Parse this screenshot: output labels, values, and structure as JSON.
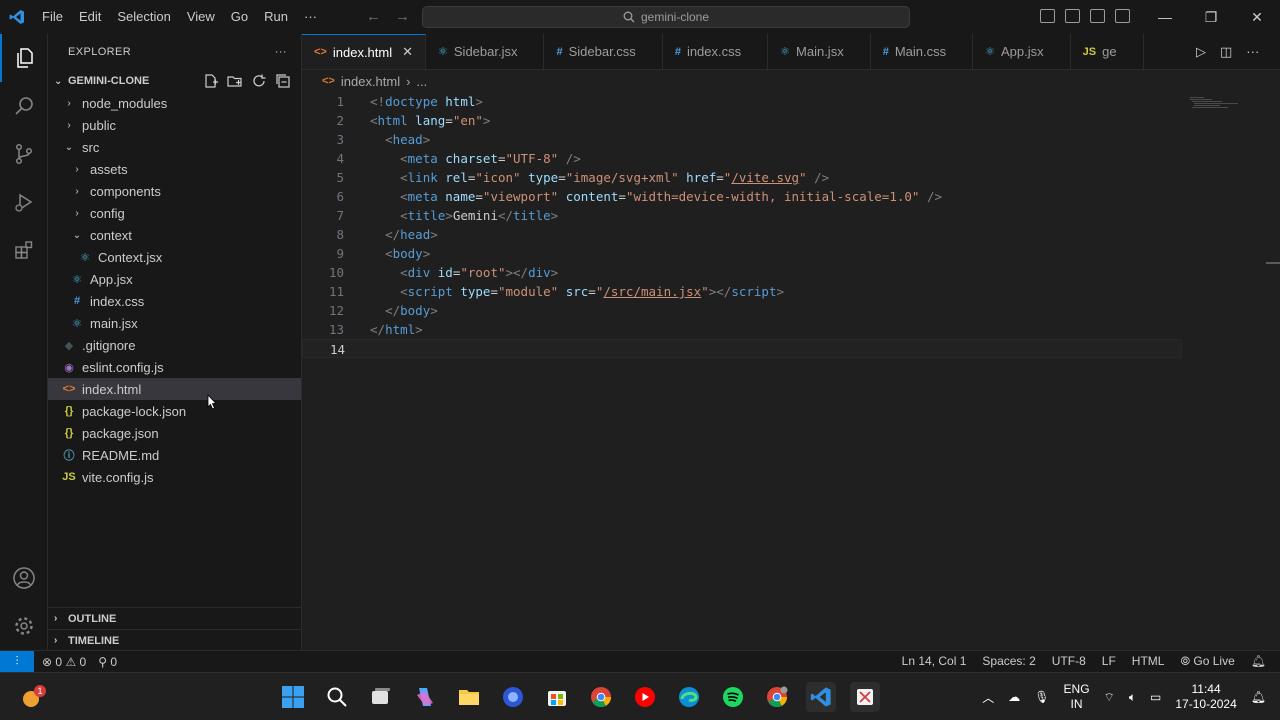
{
  "titlebar": {
    "menu": [
      "File",
      "Edit",
      "Selection",
      "View",
      "Go",
      "Run",
      "···"
    ],
    "search": "gemini-clone",
    "window_controls": [
      "minimize-icon",
      "restore-icon",
      "close-icon"
    ]
  },
  "explorer": {
    "title": "EXPLORER",
    "more": "···",
    "folder": "GEMINI-CLONE",
    "tree": [
      {
        "label": "node_modules",
        "type": "folder",
        "open": false,
        "depth": 1
      },
      {
        "label": "public",
        "type": "folder",
        "open": false,
        "depth": 1
      },
      {
        "label": "src",
        "type": "folder",
        "open": true,
        "depth": 1
      },
      {
        "label": "assets",
        "type": "folder",
        "open": false,
        "depth": 2
      },
      {
        "label": "components",
        "type": "folder",
        "open": false,
        "depth": 2
      },
      {
        "label": "config",
        "type": "folder",
        "open": false,
        "depth": 2
      },
      {
        "label": "context",
        "type": "folder",
        "open": true,
        "depth": 2
      },
      {
        "label": "Context.jsx",
        "type": "jsx",
        "depth": 3
      },
      {
        "label": "App.jsx",
        "type": "jsx",
        "depth": 2
      },
      {
        "label": "index.css",
        "type": "css",
        "depth": 2
      },
      {
        "label": "main.jsx",
        "type": "jsx",
        "depth": 2
      },
      {
        "label": ".gitignore",
        "type": "git",
        "depth": 1
      },
      {
        "label": "eslint.config.js",
        "type": "eslint",
        "depth": 1
      },
      {
        "label": "index.html",
        "type": "html",
        "depth": 1,
        "selected": true
      },
      {
        "label": "package-lock.json",
        "type": "json",
        "depth": 1
      },
      {
        "label": "package.json",
        "type": "json",
        "depth": 1
      },
      {
        "label": "README.md",
        "type": "info",
        "depth": 1
      },
      {
        "label": "vite.config.js",
        "type": "js",
        "depth": 1
      }
    ],
    "outline": "OUTLINE",
    "timeline": "TIMELINE"
  },
  "tabs": [
    {
      "label": "index.html",
      "type": "html",
      "active": true
    },
    {
      "label": "Sidebar.jsx",
      "type": "jsx"
    },
    {
      "label": "Sidebar.css",
      "type": "css"
    },
    {
      "label": "index.css",
      "type": "css"
    },
    {
      "label": "Main.jsx",
      "type": "jsx"
    },
    {
      "label": "Main.css",
      "type": "css"
    },
    {
      "label": "App.jsx",
      "type": "jsx"
    },
    {
      "label": "ge",
      "type": "js"
    }
  ],
  "breadcrumb": {
    "file": "index.html",
    "rest": "..."
  },
  "code": [
    [
      [
        "punct",
        "<!"
      ],
      [
        "tag",
        "doctype"
      ],
      [
        "text",
        " "
      ],
      [
        "attr",
        "html"
      ],
      [
        "punct",
        ">"
      ]
    ],
    [
      [
        "punct",
        "<"
      ],
      [
        "tag",
        "html"
      ],
      [
        "text",
        " "
      ],
      [
        "attr",
        "lang"
      ],
      [
        "text",
        "="
      ],
      [
        "str",
        "\"en\""
      ],
      [
        "punct",
        ">"
      ]
    ],
    [
      [
        "text",
        "  "
      ],
      [
        "punct",
        "<"
      ],
      [
        "tag",
        "head"
      ],
      [
        "punct",
        ">"
      ]
    ],
    [
      [
        "text",
        "    "
      ],
      [
        "punct",
        "<"
      ],
      [
        "tag",
        "meta"
      ],
      [
        "text",
        " "
      ],
      [
        "attr",
        "charset"
      ],
      [
        "text",
        "="
      ],
      [
        "str",
        "\"UTF-8\""
      ],
      [
        "text",
        " "
      ],
      [
        "punct",
        "/>"
      ]
    ],
    [
      [
        "text",
        "    "
      ],
      [
        "punct",
        "<"
      ],
      [
        "tag",
        "link"
      ],
      [
        "text",
        " "
      ],
      [
        "attr",
        "rel"
      ],
      [
        "text",
        "="
      ],
      [
        "str",
        "\"icon\""
      ],
      [
        "text",
        " "
      ],
      [
        "attr",
        "type"
      ],
      [
        "text",
        "="
      ],
      [
        "str",
        "\"image/svg+xml\""
      ],
      [
        "text",
        " "
      ],
      [
        "attr",
        "href"
      ],
      [
        "text",
        "="
      ],
      [
        "str",
        "\""
      ],
      [
        "link",
        "/vite.svg"
      ],
      [
        "str",
        "\""
      ],
      [
        "text",
        " "
      ],
      [
        "punct",
        "/>"
      ]
    ],
    [
      [
        "text",
        "    "
      ],
      [
        "punct",
        "<"
      ],
      [
        "tag",
        "meta"
      ],
      [
        "text",
        " "
      ],
      [
        "attr",
        "name"
      ],
      [
        "text",
        "="
      ],
      [
        "str",
        "\"viewport\""
      ],
      [
        "text",
        " "
      ],
      [
        "attr",
        "content"
      ],
      [
        "text",
        "="
      ],
      [
        "str",
        "\"width=device-width, initial-scale=1.0\""
      ],
      [
        "text",
        " "
      ],
      [
        "punct",
        "/>"
      ]
    ],
    [
      [
        "text",
        "    "
      ],
      [
        "punct",
        "<"
      ],
      [
        "tag",
        "title"
      ],
      [
        "punct",
        ">"
      ],
      [
        "text",
        "Gemini"
      ],
      [
        "punct",
        "</"
      ],
      [
        "tag",
        "title"
      ],
      [
        "punct",
        ">"
      ]
    ],
    [
      [
        "text",
        "  "
      ],
      [
        "punct",
        "</"
      ],
      [
        "tag",
        "head"
      ],
      [
        "punct",
        ">"
      ]
    ],
    [
      [
        "text",
        "  "
      ],
      [
        "punct",
        "<"
      ],
      [
        "tag",
        "body"
      ],
      [
        "punct",
        ">"
      ]
    ],
    [
      [
        "text",
        "    "
      ],
      [
        "punct",
        "<"
      ],
      [
        "tag",
        "div"
      ],
      [
        "text",
        " "
      ],
      [
        "attr",
        "id"
      ],
      [
        "text",
        "="
      ],
      [
        "str",
        "\"root\""
      ],
      [
        "punct",
        "></"
      ],
      [
        "tag",
        "div"
      ],
      [
        "punct",
        ">"
      ]
    ],
    [
      [
        "text",
        "    "
      ],
      [
        "punct",
        "<"
      ],
      [
        "tag",
        "script"
      ],
      [
        "text",
        " "
      ],
      [
        "attr",
        "type"
      ],
      [
        "text",
        "="
      ],
      [
        "str",
        "\"module\""
      ],
      [
        "text",
        " "
      ],
      [
        "attr",
        "src"
      ],
      [
        "text",
        "="
      ],
      [
        "str",
        "\""
      ],
      [
        "link",
        "/src/main.jsx"
      ],
      [
        "str",
        "\""
      ],
      [
        "punct",
        "></"
      ],
      [
        "tag",
        "script"
      ],
      [
        "punct",
        ">"
      ]
    ],
    [
      [
        "text",
        "  "
      ],
      [
        "punct",
        "</"
      ],
      [
        "tag",
        "body"
      ],
      [
        "punct",
        ">"
      ]
    ],
    [
      [
        "punct",
        "</"
      ],
      [
        "tag",
        "html"
      ],
      [
        "punct",
        ">"
      ]
    ],
    []
  ],
  "current_line": 14,
  "status": {
    "errors": "0",
    "warnings": "0",
    "ports": "0",
    "position": "Ln 14, Col 1",
    "spaces": "Spaces: 2",
    "encoding": "UTF-8",
    "eol": "LF",
    "language": "HTML",
    "golive": "Go Live"
  },
  "taskbar": {
    "lang_top": "ENG",
    "lang_bottom": "IN",
    "time": "11:44",
    "date": "17-10-2024",
    "badge": "1"
  },
  "colors": {
    "accent": "#0078d4",
    "tag": "#569cd6",
    "attr": "#9cdcfe",
    "string": "#ce9178"
  }
}
